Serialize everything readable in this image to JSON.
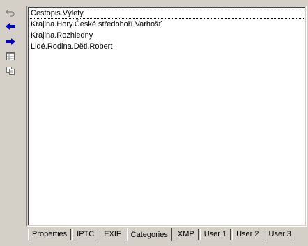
{
  "toolbar": {
    "icons": [
      "undo-icon",
      "back-arrow-icon",
      "forward-arrow-icon",
      "table-icon",
      "copy-icon"
    ]
  },
  "categories": {
    "items": [
      "Cestopis.Výlety",
      "Krajina.Hory.České středohoří.Varhošť",
      "Krajina.Rozhledny",
      "Lidé.Rodina.Děti.Robert"
    ]
  },
  "tabs": [
    "Properties",
    "IPTC",
    "EXIF",
    "Categories",
    "XMP",
    "User 1",
    "User 2",
    "User 3"
  ],
  "active_tab": "Categories",
  "colors": {
    "face": "#d4d0c8",
    "arrow": "#0000c0",
    "list_bg": "#ffffff"
  }
}
